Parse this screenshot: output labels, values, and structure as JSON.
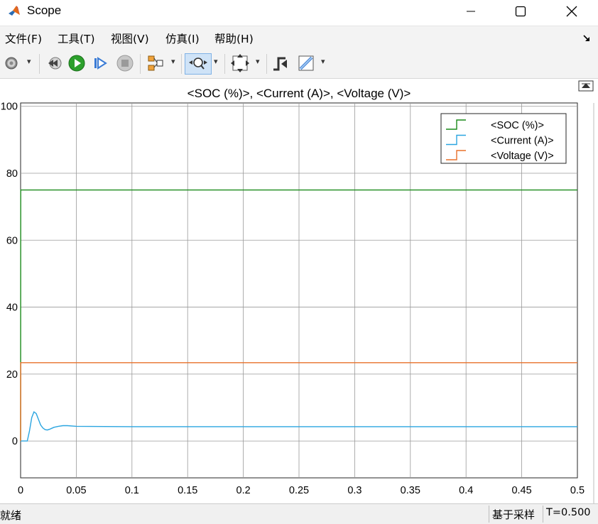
{
  "window": {
    "title": "Scope",
    "logo_icon": "matlab-logo-icon",
    "minimize_icon": "minimize-icon",
    "maximize_icon": "maximize-icon",
    "close_icon": "close-icon"
  },
  "menu": {
    "items": [
      "文件(F)",
      "工具(T)",
      "视图(V)",
      "仿真(I)",
      "帮助(H)"
    ],
    "dock_icon": "dock-arrow-icon"
  },
  "toolbar": {
    "icons": [
      "gear-icon",
      "step-back-icon",
      "run-icon",
      "step-forward-icon",
      "stop-icon",
      "signal-select-icon",
      "zoom-icon",
      "autoscale-icon",
      "cursor-measure-icon",
      "triggers-icon"
    ],
    "run_color": "#2ca02c"
  },
  "chart_data": {
    "type": "line",
    "title": "<SOC (%)>, <Current (A)>, <Voltage (V)>",
    "xlabel": "",
    "ylabel": "",
    "xlim": [
      0,
      0.5
    ],
    "ylim": [
      -11,
      101
    ],
    "x_ticks": [
      "0",
      "0.05",
      "0.1",
      "0.15",
      "0.2",
      "0.25",
      "0.3",
      "0.35",
      "0.4",
      "0.45",
      "0.5"
    ],
    "y_ticks": [
      "100",
      "80",
      "60",
      "40",
      "20",
      "0"
    ],
    "grid": true,
    "legend_position": "top-right",
    "series": [
      {
        "name": "<SOC (%)>",
        "color": "#1a8a1a",
        "x": [
          0,
          0.0001,
          0.5
        ],
        "y": [
          0,
          75,
          75
        ]
      },
      {
        "name": "<Current (A)>",
        "color": "#2aa5e0",
        "x": [
          0,
          0.006,
          0.008,
          0.01,
          0.012,
          0.014,
          0.016,
          0.018,
          0.02,
          0.022,
          0.024,
          0.026,
          0.028,
          0.03,
          0.034,
          0.038,
          0.042,
          0.05,
          0.1,
          0.2,
          0.3,
          0.4,
          0.5
        ],
        "y": [
          0,
          0,
          3,
          7,
          8.7,
          8.2,
          6.5,
          4.8,
          3.9,
          3.4,
          3.3,
          3.5,
          3.8,
          4.1,
          4.4,
          4.6,
          4.6,
          4.4,
          4.3,
          4.3,
          4.3,
          4.3,
          4.3
        ]
      },
      {
        "name": "<Voltage (V)>",
        "color": "#e8702a",
        "x": [
          0,
          0.0001,
          0.5
        ],
        "y": [
          0,
          23.4,
          23.4
        ]
      }
    ]
  },
  "plot_corner_icon": "restore-plot-icon",
  "status": {
    "left": "就绪",
    "mode": "基于采样",
    "time": "T=0.500"
  }
}
